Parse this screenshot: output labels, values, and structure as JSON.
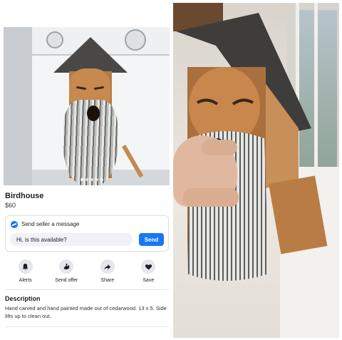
{
  "listing": {
    "title": "Birdhouse",
    "price": "$60",
    "message": {
      "label": "Send seller a message",
      "input_value": "Hi, is this available?",
      "send_label": "Send"
    },
    "actions": [
      {
        "label": "Alerts",
        "icon": "bell-icon"
      },
      {
        "label": "Send offer",
        "icon": "send-offer-icon"
      },
      {
        "label": "Share",
        "icon": "share-icon"
      },
      {
        "label": "Save",
        "icon": "heart-icon"
      }
    ],
    "description_heading": "Description",
    "description_text": "Hand carved and hand painted made out of cedarwood. 13 x 5. Side lifts up to clean out.",
    "photo_count": 5,
    "active_photo": 1
  },
  "colors": {
    "accent": "#1877f2",
    "icon_bg": "#e4e6eb",
    "input_bg": "#f0f2f5"
  }
}
